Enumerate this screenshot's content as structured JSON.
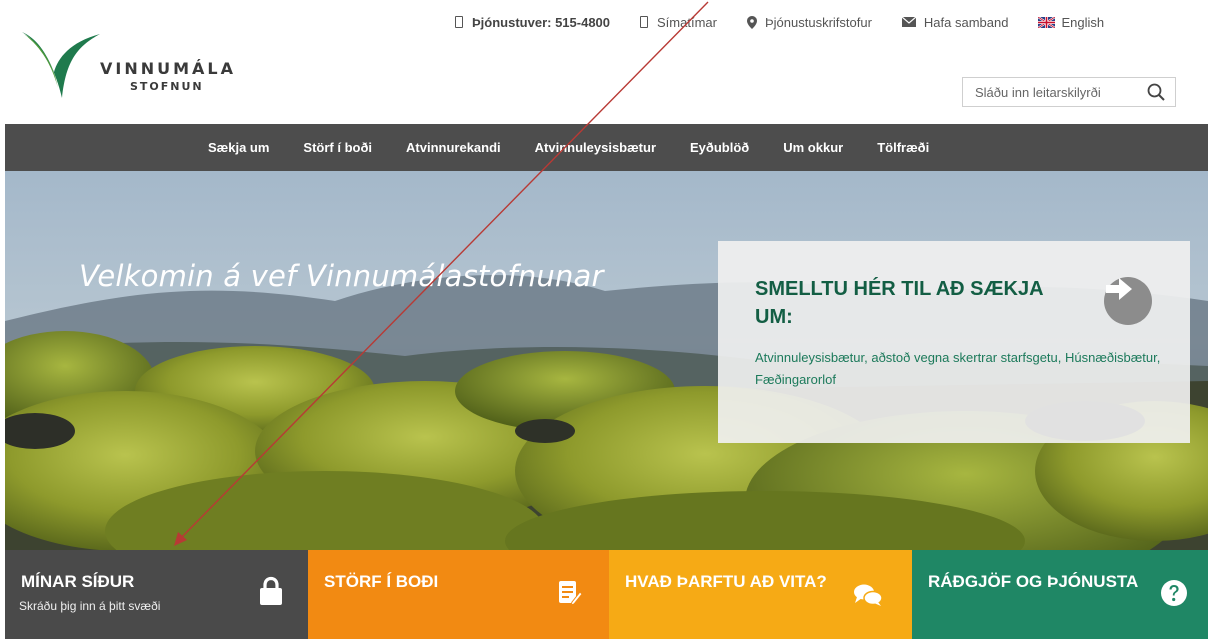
{
  "header": {
    "logo_line1": "VINNUMÁLA",
    "logo_line2": "STOFNUN",
    "toplinks": [
      {
        "label": "Þjónustuver: 515-4800",
        "icon": "phone-icon"
      },
      {
        "label": "Símatímar",
        "icon": "phone-icon"
      },
      {
        "label": "Þjónustuskrifstofur",
        "icon": "map-pin-icon"
      },
      {
        "label": "Hafa samband",
        "icon": "envelope-icon"
      },
      {
        "label": "English",
        "icon": "uk-flag-icon"
      }
    ],
    "search": {
      "placeholder": "Sláðu inn leitarskilyrði",
      "icon": "search-icon"
    }
  },
  "nav": {
    "items": [
      "Sækja um",
      "Störf í boði",
      "Atvinnurekandi",
      "Atvinnuleysisbætur",
      "Eyðublöð",
      "Um okkur",
      "Tölfræði"
    ]
  },
  "hero": {
    "title": "Velkomin á vef Vinnumálastofnunar",
    "apply": {
      "title": "SMELLTU HÉR TIL AÐ SÆKJA UM:",
      "description": "Atvinnuleysisbætur, aðstoð vegna skertrar starfsgetu, Húsnæðisbætur, Fæðingarorlof",
      "icon": "arrow-right-circle-icon"
    }
  },
  "tiles": [
    {
      "title": "MÍNAR SÍÐUR",
      "subtitle": "Skráðu þig inn á þitt svæði",
      "icon": "lock-icon",
      "color": "#4a4a4a"
    },
    {
      "title": "STÖRF Í BOÐI",
      "subtitle": "",
      "icon": "document-edit-icon",
      "color": "#f28a12"
    },
    {
      "title": "HVAÐ ÞARFTU AÐ VITA?",
      "subtitle": "",
      "icon": "chat-bubbles-icon",
      "color": "#f6aa15"
    },
    {
      "title": "RÁÐGJÖF OG ÞJÓNUSTA",
      "subtitle": "",
      "icon": "question-circle-icon",
      "color": "#1f8765"
    }
  ],
  "colors": {
    "nav_bg": "#4d4d4d",
    "brand_green": "#135e44",
    "annotation_arrow": "#b83a35"
  }
}
